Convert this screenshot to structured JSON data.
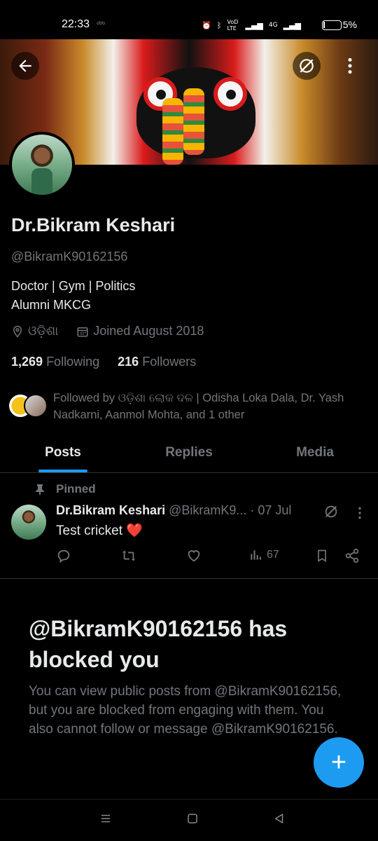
{
  "status_bar": {
    "time": "22:33",
    "small_text": "ഠ്ഠ്ഠ",
    "net1": "VoD LTE",
    "net2": "4G",
    "battery_pct": "5%",
    "battery_level": 0.05
  },
  "profile": {
    "name": "Dr.Bikram Keshari",
    "handle": "@BikramK90162156",
    "bio_line1": "Doctor |  Gym | Politics",
    "bio_line2": "Alumni MKCG",
    "location": "ଓଡ଼ିଶା",
    "joined": "Joined August 2018",
    "following_count": "1,269",
    "following_label": "Following",
    "followers_count": "216",
    "followers_label": "Followers",
    "followed_by": "Followed by ଓଡ଼ିଶା ଲୋକ ଦଳ | Odisha Loka Dala, Dr. Yash Nadkarni, Aanmol Mohta, and 1 other"
  },
  "tabs": [
    {
      "label": "Posts",
      "active": true
    },
    {
      "label": "Replies",
      "active": false
    },
    {
      "label": "Media",
      "active": false
    }
  ],
  "pinned_post": {
    "pinned_label": "Pinned",
    "author": "Dr.Bikram Keshari",
    "handle_trunc": "@BikramK9...",
    "date": "· 07 Jul",
    "text": "Test cricket",
    "emoji": "❤️",
    "views": "67"
  },
  "blocked": {
    "title": "@BikramK90162156 has blocked you",
    "message": "You can view public posts from @BikramK90162156, but you are blocked from engaging with them. You also cannot follow or message @BikramK90162156."
  },
  "fab_label": "+",
  "icons": {
    "back": "back-arrow-icon",
    "grok": "grok-icon",
    "more": "more-vertical-icon",
    "pin": "pin-icon",
    "location": "location-icon",
    "calendar": "calendar-icon"
  },
  "colors": {
    "accent": "#1d9bf0",
    "muted": "#71767b",
    "text": "#e7e9ea",
    "background": "#000000"
  }
}
